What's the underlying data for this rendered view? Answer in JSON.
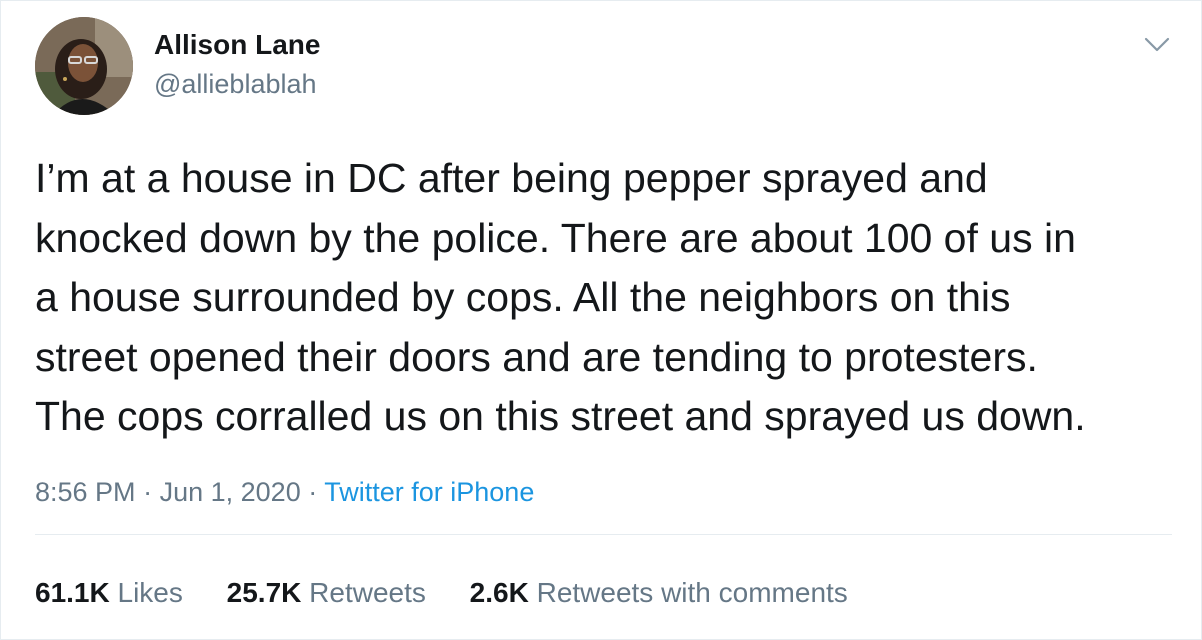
{
  "user": {
    "display_name": "Allison Lane",
    "handle": "@allieblablah"
  },
  "tweet": {
    "lines": [
      "I’m at a house in DC after being pepper sprayed and",
      "knocked down by the police. There are about 100 of us in",
      "a house surrounded by cops. All the neighbors on this",
      "street opened their doors and are tending to protesters.",
      "The cops corralled us on this street and sprayed us down."
    ]
  },
  "meta": {
    "time": "8:56 PM",
    "separator": "·",
    "date": "Jun 1, 2020",
    "source": "Twitter for iPhone"
  },
  "stats": {
    "likes_count": "61.1K",
    "likes_label": "Likes",
    "retweets_count": "25.7K",
    "retweets_label": "Retweets",
    "comments_count": "2.6K",
    "comments_label": "Retweets with comments"
  },
  "colors": {
    "text": "#14171a",
    "secondary": "#657786",
    "link": "#1b95e0",
    "divider": "#e6ecf0"
  },
  "icons": {
    "menu": "chevron-down-icon"
  }
}
